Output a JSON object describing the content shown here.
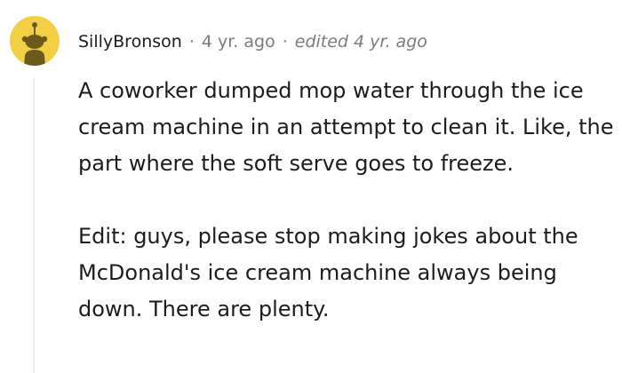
{
  "comment": {
    "username": "SillyBronson",
    "separator": "·",
    "time": "4 yr. ago",
    "edited": "edited 4 yr. ago",
    "paragraphs": [
      "A coworker dumped mop water through the ice cream machine in an attempt to clean it. Like, the part where the soft serve goes to freeze.",
      "Edit: guys, please stop making jokes about the McDonald's ice cream machine always being down. There are plenty."
    ]
  },
  "avatar": {
    "icon": "snoo-avatar-icon",
    "background_color": "#f2cf43"
  },
  "colors": {
    "text": "#1c1c1c",
    "meta": "#7c7c7c",
    "thread_line": "#edeff1"
  }
}
